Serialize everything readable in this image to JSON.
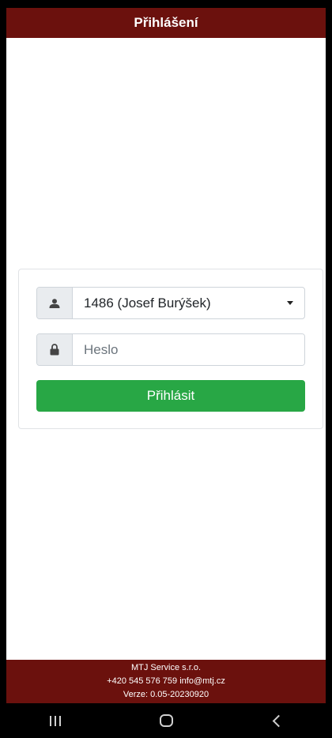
{
  "header": {
    "title": "Přihlášení"
  },
  "login": {
    "user_select_value": "1486 (Josef Burýšek)",
    "password_placeholder": "Heslo",
    "password_value": "",
    "submit_label": "Přihlásit"
  },
  "footer": {
    "company": "MTJ Service s.r.o.",
    "contact": "+420 545 576 759 info@mtj.cz",
    "version": "Verze: 0.05-20230920"
  },
  "icons": {
    "user": "user-icon",
    "password": "lock-icon",
    "dropdown": "caret-down-icon",
    "nav_recent": "recent-apps-icon",
    "nav_home": "home-icon",
    "nav_back": "back-icon"
  },
  "colors": {
    "header_bg": "#6b110d",
    "footer_bg": "#6b110d",
    "button_bg": "#28a745",
    "addon_bg": "#e9ecef"
  }
}
